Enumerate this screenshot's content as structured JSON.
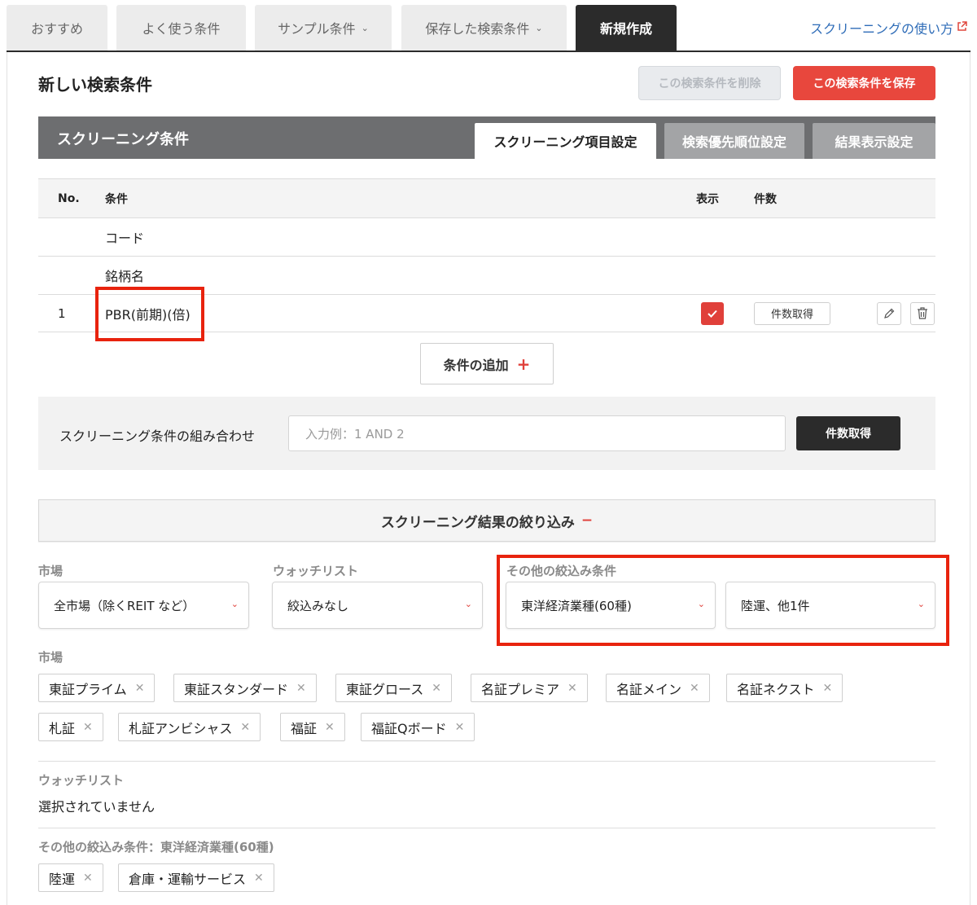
{
  "topnav": {
    "tabs": [
      {
        "label": "おすすめ"
      },
      {
        "label": "よく使う条件"
      },
      {
        "label": "サンプル条件"
      },
      {
        "label": "保存した検索条件"
      },
      {
        "label": "新規作成"
      }
    ],
    "help_link": "スクリーニングの使い方",
    "active_tab_index": 4
  },
  "header": {
    "title": "新しい検索条件",
    "delete_label": "この検索条件を削除",
    "save_label": "この検索条件を保存"
  },
  "conditions": {
    "section_title": "スクリーニング条件",
    "tabs": [
      {
        "label": "スクリーニング項目設定"
      },
      {
        "label": "検索優先順位設定"
      },
      {
        "label": "結果表示設定"
      }
    ],
    "columns": {
      "no": "No.",
      "condition": "条件",
      "show": "表示",
      "count": "件数"
    },
    "rows": [
      {
        "no": "",
        "condition": "コード"
      },
      {
        "no": "",
        "condition": "銘柄名"
      },
      {
        "no": "1",
        "condition": "PBR(前期)(倍)",
        "show_checked": true,
        "count_button": "件数取得"
      }
    ],
    "add_label": "条件の追加",
    "add_icon": "+"
  },
  "combination": {
    "label": "スクリーニング条件の組み合わせ",
    "placeholder": "入力例：1 AND 2",
    "button": "件数取得"
  },
  "refine": {
    "title": "スクリーニング結果の絞り込み",
    "toggle": "−",
    "market_label": "市場",
    "market_value": "全市場（除くREIT など）",
    "watchlist_label": "ウォッチリスト",
    "watchlist_value": "絞込みなし",
    "other_label": "その他の絞込み条件",
    "other_value_1": "東洋経済業種(60種)",
    "other_value_2": "陸運、他1件"
  },
  "summary": {
    "market_heading": "市場",
    "markets": [
      "東証プライム",
      "東証スタンダード",
      "東証グロース",
      "名証プレミア",
      "名証メイン",
      "名証ネクスト",
      "札証",
      "札証アンビシャス",
      "福証",
      "福証Qボード"
    ],
    "watchlist_heading": "ウォッチリスト",
    "watchlist_text": "選択されていません",
    "other_heading": "その他の絞込み条件：東洋経済業種(60種)",
    "others": [
      "陸運",
      "倉庫・運輸サービス"
    ]
  },
  "colors": {
    "accent": "#e0403a",
    "highlight_box": "#e8230e",
    "dark": "#2b2b2b"
  }
}
